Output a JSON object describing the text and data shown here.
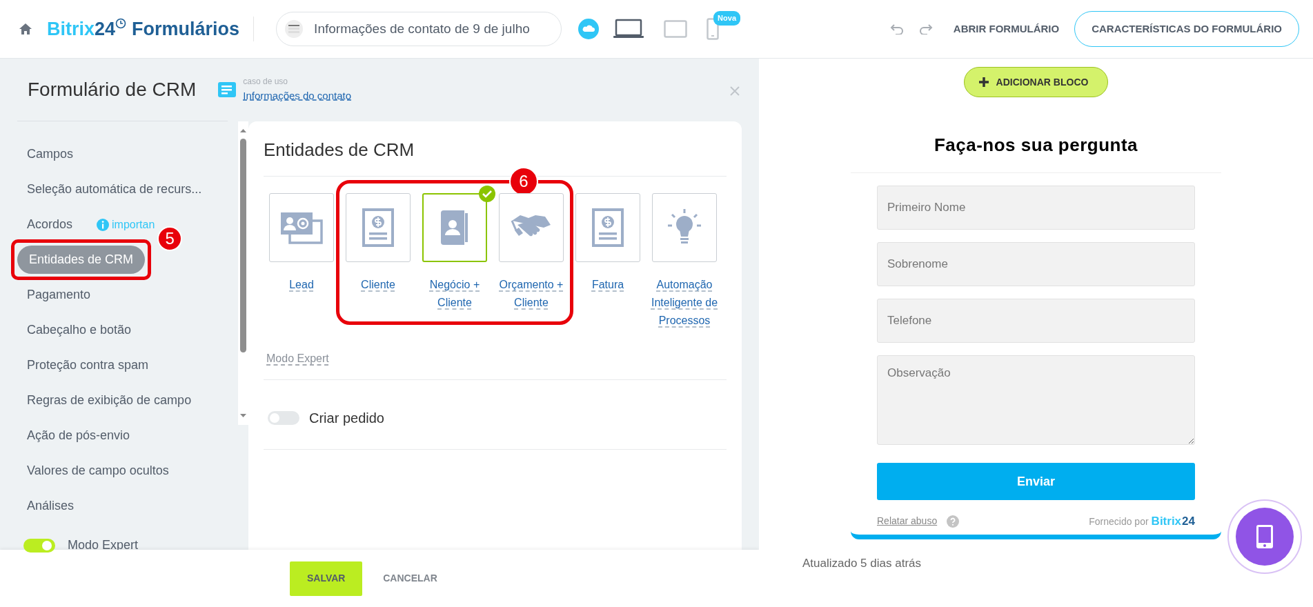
{
  "top_bar": {
    "logo": {
      "brand": "Bitrix",
      "brand_number": "24",
      "product": "Formulários"
    },
    "form_title": "Informações de contato de 9 de julho",
    "devices": [
      {
        "kind": "laptop",
        "selected": true
      },
      {
        "kind": "tablet",
        "selected": false
      },
      {
        "kind": "phone",
        "selected": false,
        "badge": "Nova"
      }
    ],
    "open_link": "ABRIR FORMULÁRIO",
    "settings_button": "CARACTERÍSTICAS DO FORMULÁRIO"
  },
  "sidebar": {
    "title": "Formulário de CRM",
    "use_case": {
      "caption": "caso de uso",
      "link": "Informações do contato"
    },
    "items": [
      {
        "label": "Campos",
        "selected": false
      },
      {
        "label": "Seleção automática de recurs...",
        "selected": false
      },
      {
        "label": "Acordos",
        "selected": false,
        "hint": "importan"
      },
      {
        "label": "Entidades de CRM",
        "selected": true,
        "callout": "5"
      },
      {
        "label": "Pagamento",
        "selected": false
      },
      {
        "label": "Cabeçalho e botão",
        "selected": false
      },
      {
        "label": "Proteção contra spam",
        "selected": false
      },
      {
        "label": "Regras de exibição de campo",
        "selected": false
      },
      {
        "label": "Ação de pós-envio",
        "selected": false
      },
      {
        "label": "Valores de campo ocultos",
        "selected": false
      },
      {
        "label": "Análises",
        "selected": false
      }
    ],
    "expert_mode": {
      "label": "Modo Expert",
      "on": true
    }
  },
  "crm_card": {
    "title": "Entidades de CRM",
    "callout": "6",
    "entities": [
      {
        "kind": "contact",
        "label": "Lead",
        "selected": false,
        "outlined": false
      },
      {
        "kind": "invoice",
        "label": "Cliente",
        "selected": false,
        "outlined": true
      },
      {
        "kind": "addressbook",
        "label": "Negócio + Cliente",
        "selected": true,
        "outlined": true
      },
      {
        "kind": "handshake",
        "label": "Orçamento + Cliente",
        "selected": false,
        "outlined": true
      },
      {
        "kind": "invoice",
        "label": "Fatura",
        "selected": false,
        "outlined": false
      },
      {
        "kind": "bulb",
        "label": "Automação Inteligente de Processos",
        "selected": false,
        "outlined": false
      }
    ],
    "expert_link": "Modo Expert",
    "order_toggle": {
      "label": "Criar pedido",
      "on": false
    }
  },
  "footer": {
    "save": "SALVAR",
    "cancel": "CANCELAR"
  },
  "preview": {
    "add_block": "ADICIONAR BLOCO",
    "form_heading": "Faça-nos sua pergunta",
    "fields": [
      {
        "kind": "text",
        "placeholder": "Primeiro Nome"
      },
      {
        "kind": "text",
        "placeholder": "Sobrenome"
      },
      {
        "kind": "text",
        "placeholder": "Telefone"
      },
      {
        "kind": "textarea",
        "placeholder": "Observação"
      }
    ],
    "submit": "Enviar",
    "report_abuse": "Relatar abuso",
    "powered_by": "Fornecido por",
    "powered_brand": "Bitrix",
    "powered_number": "24",
    "updated": "Atualizado 5 dias atrás"
  }
}
